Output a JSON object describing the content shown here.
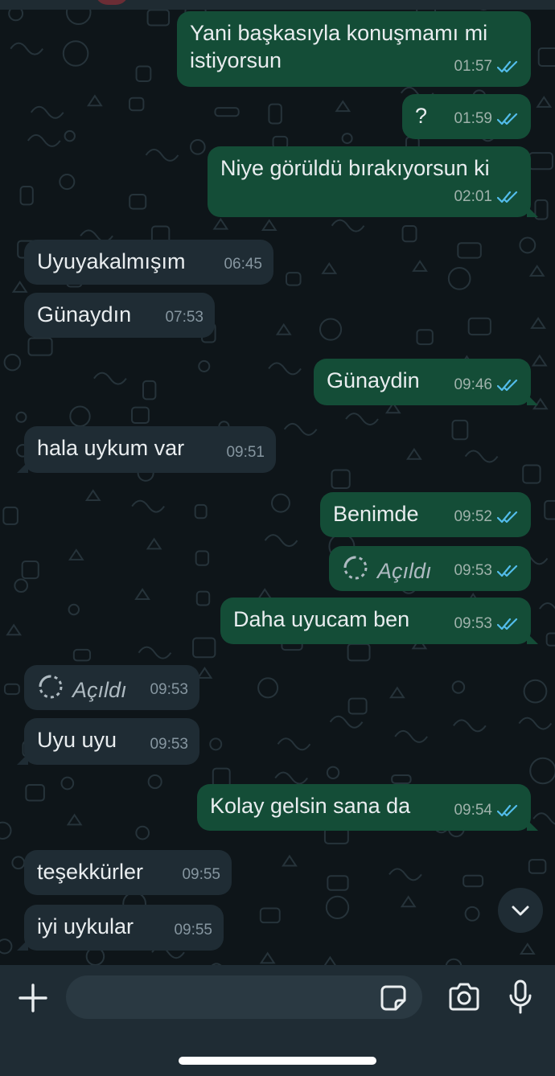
{
  "messages": [
    {
      "dir": "out",
      "lines": [
        "Yani başkasıyla konuşmamı mi",
        "istiyorsun"
      ],
      "time": "01:57",
      "read": true
    },
    {
      "dir": "out",
      "lines": [
        "?"
      ],
      "time": "01:59",
      "read": true
    },
    {
      "dir": "out",
      "lines": [
        "Niye görüldü bırakıyorsun ki"
      ],
      "time": "02:01",
      "read": true
    },
    {
      "dir": "in",
      "lines": [
        "Uyuyakalmışım"
      ],
      "time": "06:45"
    },
    {
      "dir": "in",
      "lines": [
        "Günaydın"
      ],
      "time": "07:53"
    },
    {
      "dir": "out",
      "lines": [
        "Günaydin"
      ],
      "time": "09:46",
      "read": true
    },
    {
      "dir": "in",
      "lines": [
        "hala uykum var"
      ],
      "time": "09:51"
    },
    {
      "dir": "out",
      "lines": [
        "Benimde"
      ],
      "time": "09:52",
      "read": true
    },
    {
      "dir": "out",
      "opened": "Açıldı",
      "time": "09:53",
      "read": true
    },
    {
      "dir": "out",
      "lines": [
        "Daha uyucam ben"
      ],
      "time": "09:53",
      "read": true
    },
    {
      "dir": "in",
      "opened": "Açıldı",
      "time": "09:53"
    },
    {
      "dir": "in",
      "lines": [
        "Uyu uyu"
      ],
      "time": "09:53"
    },
    {
      "dir": "out",
      "lines": [
        "Kolay gelsin sana da"
      ],
      "time": "09:54",
      "read": true
    },
    {
      "dir": "in",
      "lines": [
        "teşekkürler"
      ],
      "time": "09:55"
    },
    {
      "dir": "in",
      "lines": [
        "iyi uykular"
      ],
      "time": "09:55"
    }
  ],
  "input": {
    "value": ""
  },
  "icons": {
    "attach": "plus-icon",
    "sticker": "sticker-icon",
    "camera": "camera-icon",
    "mic": "microphone-icon",
    "scroll": "chevron-down-icon",
    "opened": "view-once-icon",
    "ticks": "double-check-icon"
  },
  "colors": {
    "background": "#0b141a",
    "outgoing_bubble": "#144d37",
    "incoming_bubble": "#1f2c34",
    "read_ticks": "#53bdeb",
    "bottom_bar": "#1f2c34"
  }
}
